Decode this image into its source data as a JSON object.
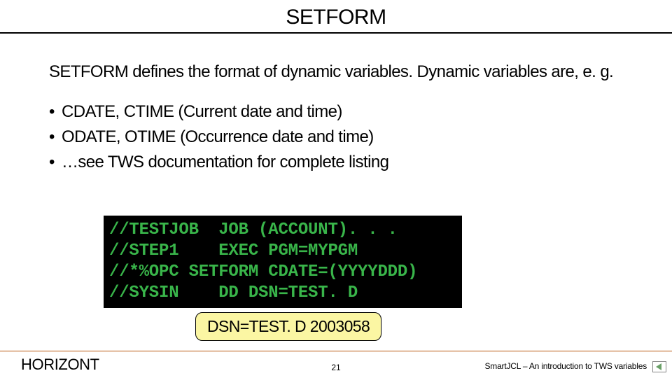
{
  "title": "SETFORM",
  "intro": "SETFORM defines the format of dynamic variables. Dynamic variables are, e. g.",
  "bullets": [
    "CDATE, CTIME (Current date and time)",
    "ODATE, OTIME (Occurrence date and time)",
    "…see TWS documentation for complete listing"
  ],
  "code_lines": [
    "//TESTJOB  JOB (ACCOUNT). . .",
    "//STEP1    EXEC PGM=MYPGM",
    "//*%OPC SETFORM CDATE=(YYYYDDD)",
    "//SYSIN    DD DSN=TEST. D"
  ],
  "callout": "DSN=TEST. D 2003058",
  "footer": {
    "left": "HORIZONT",
    "page": "21",
    "right": "SmartJCL – An introduction to TWS variables"
  }
}
